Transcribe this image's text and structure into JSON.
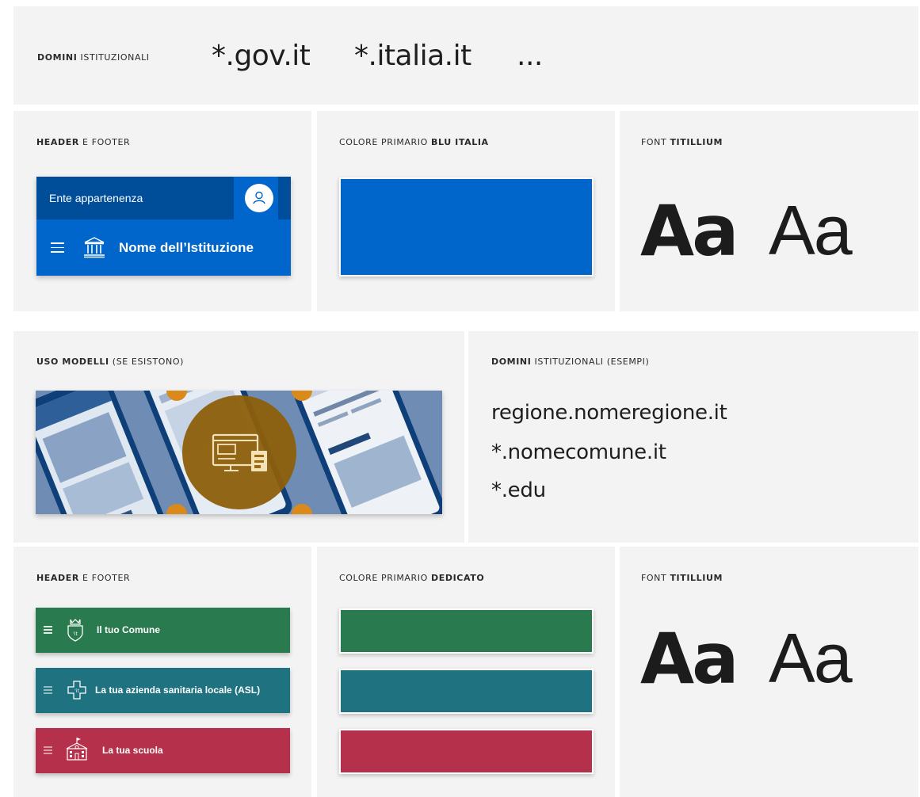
{
  "top": {
    "label_bold": "DOMINI",
    "label_rest": " ISTITUZIONALI",
    "domains": [
      "*.gov.it",
      "*.italia.it",
      "..."
    ]
  },
  "row1": {
    "header_label_bold": "HEADER",
    "header_label_rest": " E FOOTER",
    "header_mock": {
      "top_text": "Ente appartenenza",
      "name": "Nome dell’Istituzione"
    },
    "color_label_rest": "COLORE PRIMARIO ",
    "color_label_bold": "BLU ITALIA",
    "color_hex": "#0066cc",
    "font_label_rest": "FONT ",
    "font_label_bold": "TITILLIUM",
    "aa_bold": "Aa",
    "aa_thin": "Aa"
  },
  "row2": {
    "models_label_bold": "USO MODELLI",
    "models_label_rest": " (SE ESISTONO)",
    "domains_label_bold": "DOMINI",
    "domains_label_rest": " ISTITUZIONALI (ESEMPI)",
    "examples": [
      "regione.nomeregione.it",
      "*.nomecomune.it",
      "*.edu"
    ]
  },
  "row3": {
    "header_label_bold": "HEADER",
    "header_label_rest": " E FOOTER",
    "bars": [
      {
        "text": "Il tuo Comune",
        "color": "#2a7a4f",
        "icon": "shield-crown-icon"
      },
      {
        "text": "La tua azienda sanitaria locale (ASL)",
        "color": "#1f7280",
        "icon": "medical-cross-icon"
      },
      {
        "text": "La tua scuola",
        "color": "#b5304a",
        "icon": "school-building-icon"
      }
    ],
    "color_label_rest": "COLORE PRIMARIO ",
    "color_label_bold": "DEDICATO",
    "swatches": [
      "#2a7a4f",
      "#1f7280",
      "#b5304a"
    ],
    "font_label_rest": "FONT ",
    "font_label_bold": "TITILLIUM",
    "aa_bold": "Aa",
    "aa_thin": "Aa"
  }
}
